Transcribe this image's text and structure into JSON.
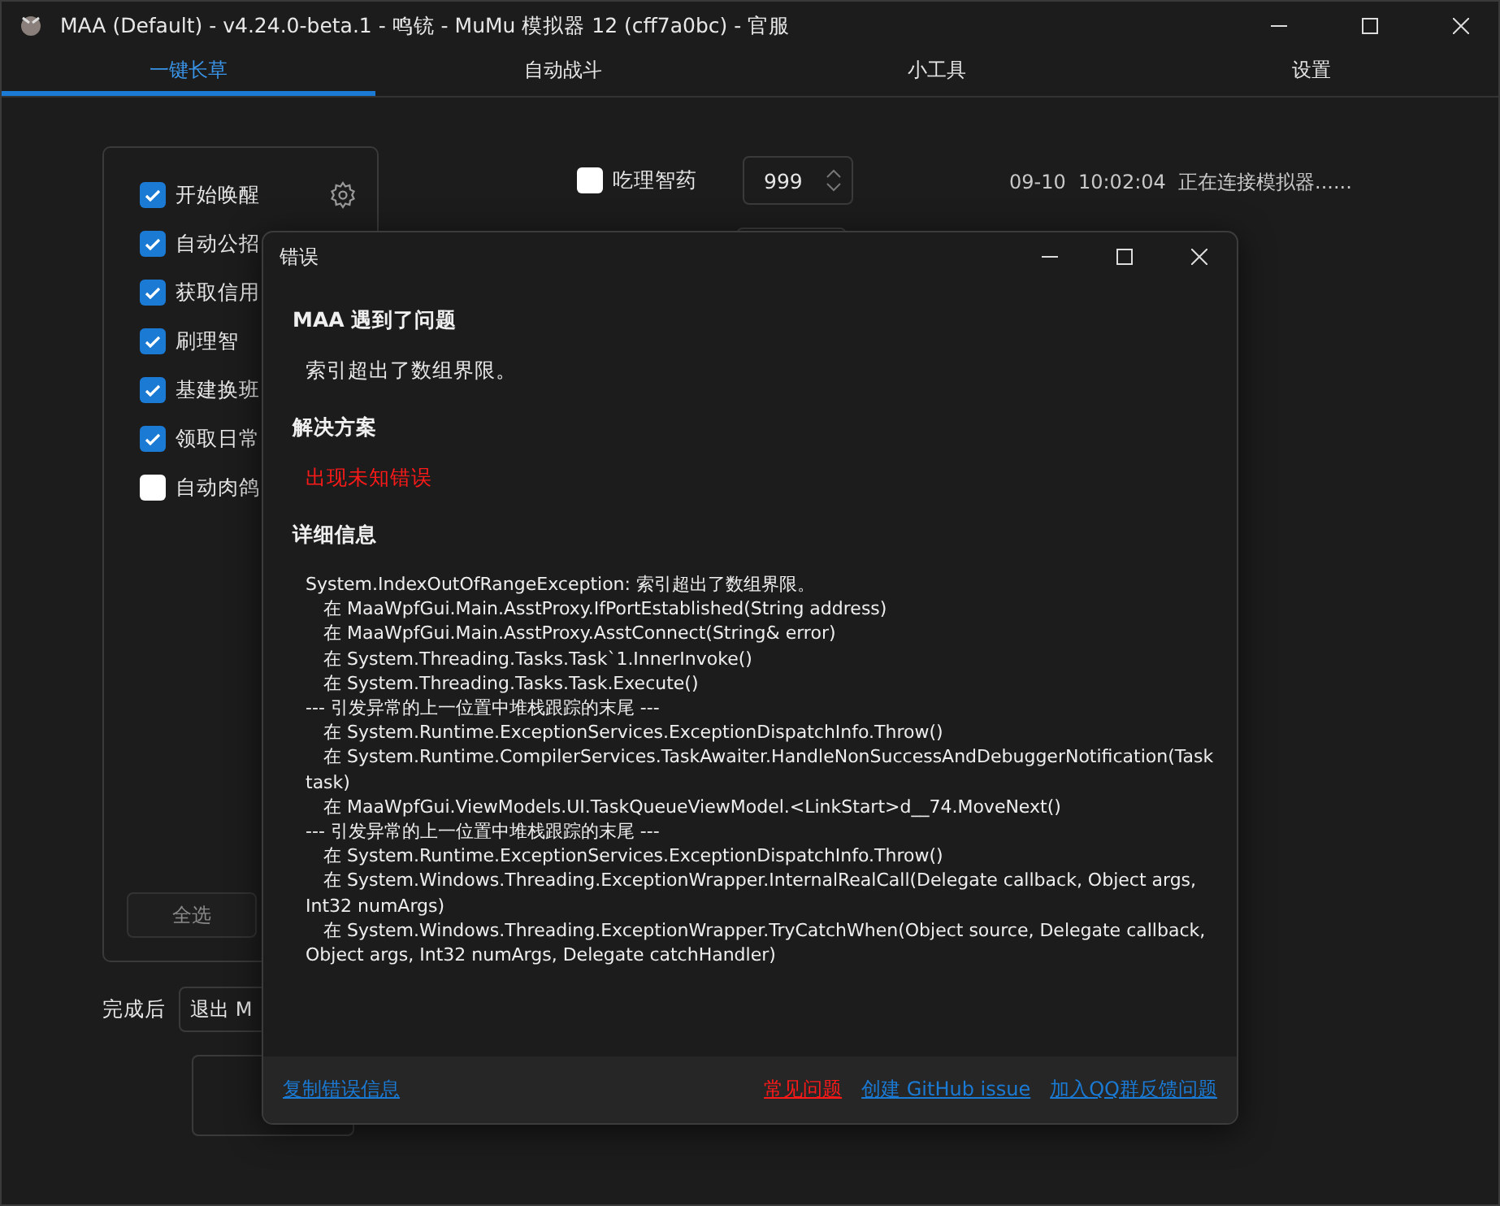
{
  "window": {
    "title": "MAA (Default) - v4.24.0-beta.1 - 鸣铳 - MuMu 模拟器 12 (cff7a0bc) - 官服"
  },
  "tabs": [
    {
      "label": "一键长草",
      "selected": true
    },
    {
      "label": "自动战斗",
      "selected": false
    },
    {
      "label": "小工具",
      "selected": false
    },
    {
      "label": "设置",
      "selected": false
    }
  ],
  "tasks": [
    {
      "label": "开始唤醒",
      "checked": true
    },
    {
      "label": "自动公招",
      "checked": true
    },
    {
      "label": "获取信用",
      "checked": true
    },
    {
      "label": "刷理智",
      "checked": true
    },
    {
      "label": "基建换班",
      "checked": true
    },
    {
      "label": "领取日常",
      "checked": true
    },
    {
      "label": "自动肉鸽",
      "checked": false
    }
  ],
  "select_all": "全选",
  "after_finish": {
    "label": "完成后",
    "value": "退出 M"
  },
  "medicine": {
    "label": "吃理智药",
    "checked": false,
    "value": "999"
  },
  "log": [
    {
      "time": "09-10  10:02:04",
      "message": "正在连接模拟器......"
    }
  ],
  "dialog": {
    "title": "错误",
    "heading": "MAA 遇到了问题",
    "message": "索引超出了数组界限。",
    "solution_heading": "解决方案",
    "solution": "出现未知错误",
    "details_heading": "详细信息",
    "details": [
      {
        "text": "System.IndexOutOfRangeException: 索引超出了数组界限。",
        "indent": false
      },
      {
        "text": "在 MaaWpfGui.Main.AsstProxy.IfPortEstablished(String address)",
        "indent": true
      },
      {
        "text": "在 MaaWpfGui.Main.AsstProxy.AsstConnect(String& error)",
        "indent": true
      },
      {
        "text": "在 System.Threading.Tasks.Task`1.InnerInvoke()",
        "indent": true
      },
      {
        "text": "在 System.Threading.Tasks.Task.Execute()",
        "indent": true
      },
      {
        "text": "--- 引发异常的上一位置中堆栈跟踪的末尾 ---",
        "indent": false
      },
      {
        "text": "在 System.Runtime.ExceptionServices.ExceptionDispatchInfo.Throw()",
        "indent": true
      },
      {
        "text": "在 System.Runtime.CompilerServices.TaskAwaiter.HandleNonSuccessAndDebuggerNotification(Task task)",
        "indent": true
      },
      {
        "text": "在 MaaWpfGui.ViewModels.UI.TaskQueueViewModel.<LinkStart>d__74.MoveNext()",
        "indent": true
      },
      {
        "text": "--- 引发异常的上一位置中堆栈跟踪的末尾 ---",
        "indent": false
      },
      {
        "text": "在 System.Runtime.ExceptionServices.ExceptionDispatchInfo.Throw()",
        "indent": true
      },
      {
        "text": "在 System.Windows.Threading.ExceptionWrapper.InternalRealCall(Delegate callback, Object args, Int32 numArgs)",
        "indent": true
      },
      {
        "text": "在 System.Windows.Threading.ExceptionWrapper.TryCatchWhen(Object source, Delegate callback, Object args, Int32 numArgs, Delegate catchHandler)",
        "indent": true
      }
    ],
    "links": [
      {
        "label": "复制错误信息",
        "kind": "primary"
      },
      {
        "label": "常见问题",
        "kind": "warning"
      },
      {
        "label": "创建 GitHub issue",
        "kind": "primary"
      },
      {
        "label": "加入QQ群反馈问题",
        "kind": "primary"
      }
    ]
  }
}
